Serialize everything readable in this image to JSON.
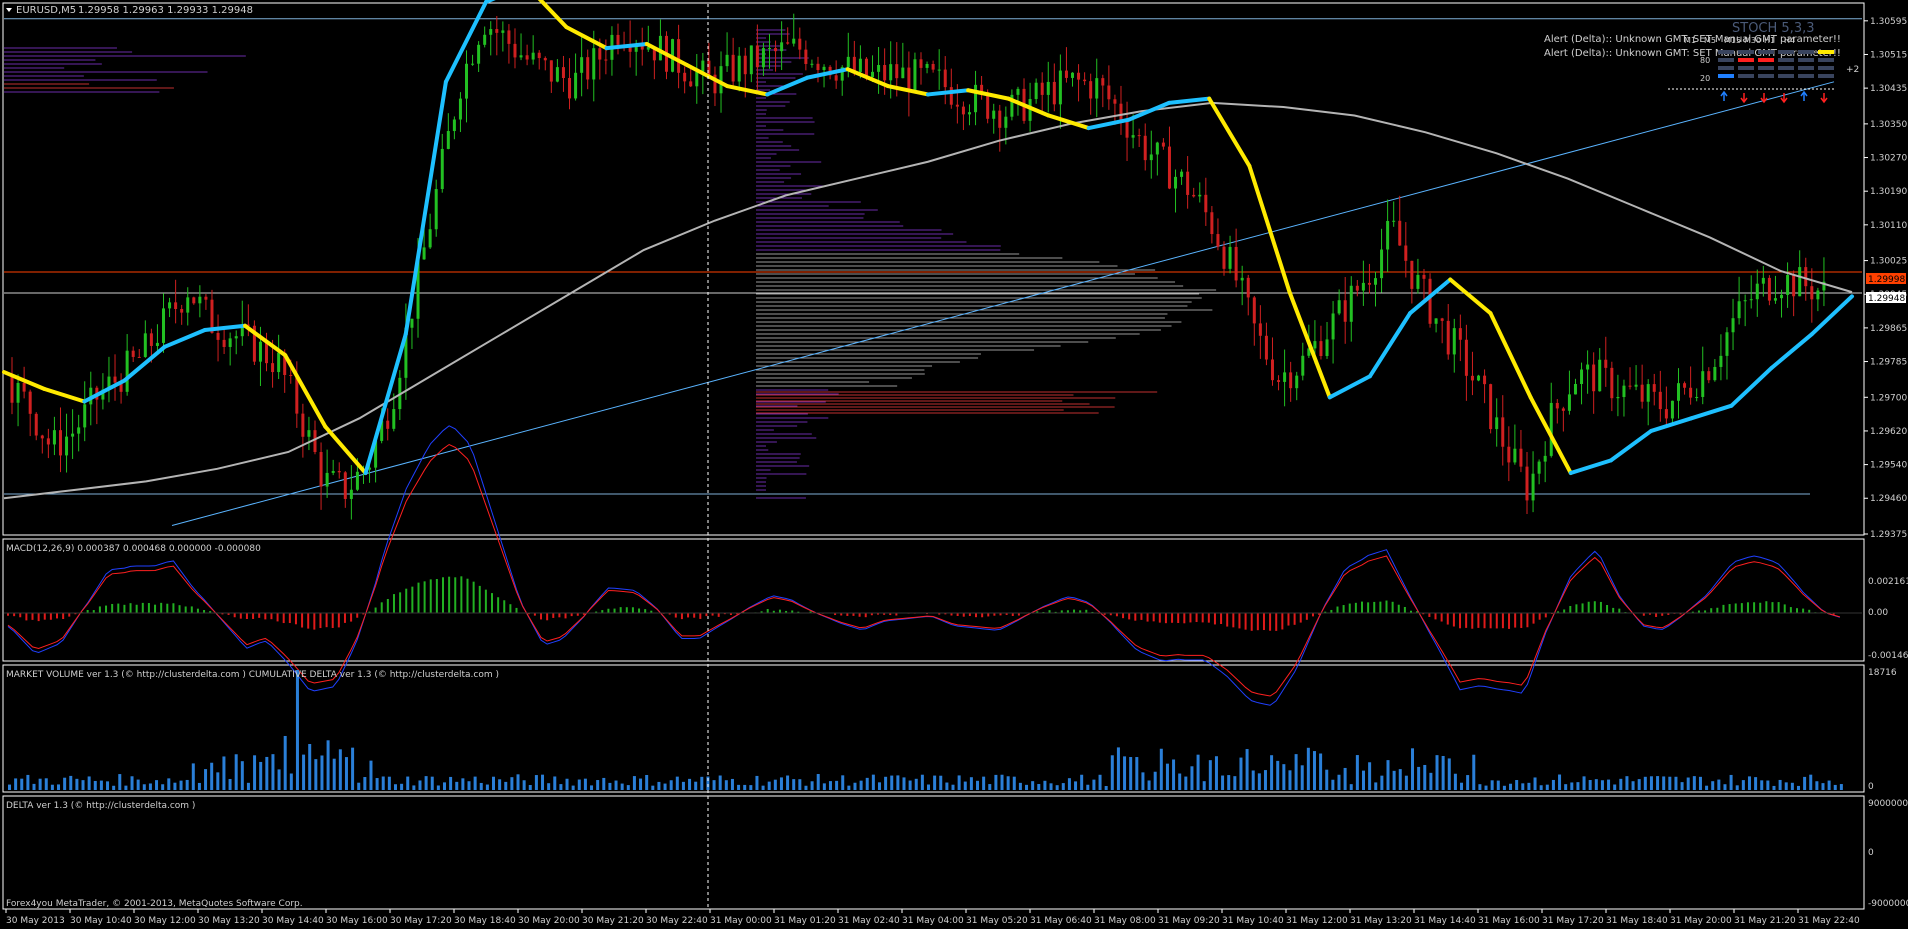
{
  "header": {
    "symbol": "EURUSD,M5",
    "ohlc": "1.29958 1.29963 1.29933 1.29948",
    "stoch_label": "STOCH 5,3,3",
    "alert1": "Alert (Delta):: Unknown GMT: SET Manual GMT parameter!!",
    "alert2": "Alert (Delta):: Unknown GMT: SET Manual GMT parameter!!",
    "tf_labels": [
      "M1",
      "M5",
      "M15",
      "M30",
      "H1",
      "H4"
    ],
    "stoch_levels": [
      "80",
      "20"
    ],
    "plus2": "+2"
  },
  "price_axis": {
    "ticks": [
      "1.30595",
      "1.30515",
      "1.30435",
      "1.30350",
      "1.30270",
      "1.30190",
      "1.30110",
      "1.30025",
      "1.29945",
      "1.29865",
      "1.29785",
      "1.29700",
      "1.29620",
      "1.29540",
      "1.29460",
      "1.29375"
    ],
    "bid_label": "1.29948",
    "red_label": "1.29998",
    "red_color": "#ff4000",
    "bid_color": "#ffffff"
  },
  "macd": {
    "label": "MACD(12,26,9) 0.000387 0.000468 0.000000 -0.000080",
    "ticks": [
      "0.002161",
      "0.00",
      "-0.001463"
    ]
  },
  "volume": {
    "label": "MARKET VOLUME ver 1.3 (© http://clusterdelta.com )  CUMULATIVE DELTA ver 1.3 (© http://clusterdelta.com )",
    "ticks": [
      "18716",
      "0"
    ]
  },
  "delta": {
    "label": "DELTA ver 1.3 (© http://clusterdelta.com )",
    "ticks": [
      "9000000",
      "0",
      "-9000000"
    ]
  },
  "copyright": "Forex4you MetaTrader, © 2001-2013, MetaQuotes Software Corp.",
  "time_axis": [
    "30 May 2013",
    "30 May 10:40",
    "30 May 12:00",
    "30 May 13:20",
    "30 May 14:40",
    "30 May 16:00",
    "30 May 17:20",
    "30 May 18:40",
    "30 May 20:00",
    "30 May 21:20",
    "30 May 22:40",
    "31 May 00:00",
    "31 May 01:20",
    "31 May 02:40",
    "31 May 04:00",
    "31 May 05:20",
    "31 May 06:40",
    "31 May 08:00",
    "31 May 09:20",
    "31 May 10:40",
    "31 May 12:00",
    "31 May 13:20",
    "31 May 14:40",
    "31 May 16:00",
    "31 May 17:20",
    "31 May 18:40",
    "31 May 20:00",
    "31 May 21:20",
    "31 May 22:40"
  ],
  "chart_data": {
    "type": "line",
    "title": "EURUSD,M5",
    "x_labels": [
      "30 May 2013",
      "30 May 10:40",
      "30 May 12:00",
      "30 May 13:20",
      "30 May 14:40",
      "30 May 16:00",
      "30 May 17:20",
      "30 May 18:40",
      "30 May 20:00",
      "30 May 21:20",
      "30 May 22:40",
      "31 May 00:00",
      "31 May 01:20",
      "31 May 02:40",
      "31 May 04:00",
      "31 May 05:20",
      "31 May 06:40",
      "31 May 08:00",
      "31 May 09:20",
      "31 May 10:40",
      "31 May 12:00",
      "31 May 13:20",
      "31 May 14:40",
      "31 May 16:00",
      "31 May 17:20",
      "31 May 18:40",
      "31 May 20:00",
      "31 May 21:20",
      "31 May 22:40"
    ],
    "ylim": [
      1.29375,
      1.30635
    ],
    "grid": false,
    "price_path": [
      1.2975,
      1.2968,
      1.2958,
      1.2962,
      1.297,
      1.2975,
      1.298,
      1.2988,
      1.2996,
      1.2988,
      1.2985,
      1.2982,
      1.2978,
      1.2965,
      1.295,
      1.2948,
      1.2955,
      1.297,
      1.2995,
      1.302,
      1.3045,
      1.306,
      1.3055,
      1.305,
      1.3047,
      1.3045,
      1.305,
      1.3058,
      1.3055,
      1.3052,
      1.3048,
      1.3045,
      1.3048,
      1.305,
      1.3052,
      1.3053,
      1.305,
      1.3048,
      1.3046,
      1.3047,
      1.3046,
      1.3045,
      1.3042,
      1.304,
      1.3038,
      1.304,
      1.3043,
      1.3045,
      1.3044,
      1.3038,
      1.303,
      1.3025,
      1.302,
      1.3012,
      1.3,
      1.2985,
      1.2975,
      1.2978,
      1.2985,
      1.2992,
      1.3,
      1.301,
      1.2998,
      1.2988,
      1.298,
      1.297,
      1.2958,
      1.2948,
      1.2965,
      1.2975,
      1.2975,
      1.2972,
      1.297,
      1.2968,
      1.2972,
      1.2978,
      1.2988,
      1.2995,
      1.2998,
      1.2997,
      1.2995
    ],
    "series": [
      {
        "name": "fast MA",
        "color": "#ffea00",
        "values": [
          1.2976,
          1.2972,
          1.2969,
          1.2974,
          1.2982,
          1.2986,
          1.2987,
          1.298,
          1.2963,
          1.2952,
          1.2985,
          1.3045,
          1.3064,
          1.3068,
          1.3058,
          1.3053,
          1.3054,
          1.3049,
          1.3044,
          1.3042,
          1.3046,
          1.3048,
          1.3044,
          1.3042,
          1.3043,
          1.3041,
          1.3037,
          1.3034,
          1.3036,
          1.304,
          1.3041,
          1.3025,
          1.2995,
          1.297,
          1.2975,
          1.299,
          1.2998,
          1.299,
          1.297,
          1.2952,
          1.2955,
          1.2962,
          1.2965,
          1.2968,
          1.2977,
          1.2985,
          1.2994
        ]
      },
      {
        "name": "slow MA",
        "color": "#b4b4b4",
        "values": [
          1.2946,
          1.2948,
          1.295,
          1.2953,
          1.2957,
          1.2965,
          1.2975,
          1.2985,
          1.2995,
          1.3005,
          1.3012,
          1.3018,
          1.3022,
          1.3026,
          1.3031,
          1.3035,
          1.3038,
          1.304,
          1.3039,
          1.3037,
          1.3033,
          1.3028,
          1.3022,
          1.3015,
          1.3008,
          1.3,
          1.2995
        ]
      }
    ],
    "horizontal_levels": [
      1.306,
      1.29998,
      1.29948,
      1.2947
    ],
    "trendline": {
      "from": [
        "30 May 14:40",
        1.294
      ],
      "to": [
        "31 May 21:20",
        1.3045
      ],
      "color": "#5ab4ff"
    }
  }
}
